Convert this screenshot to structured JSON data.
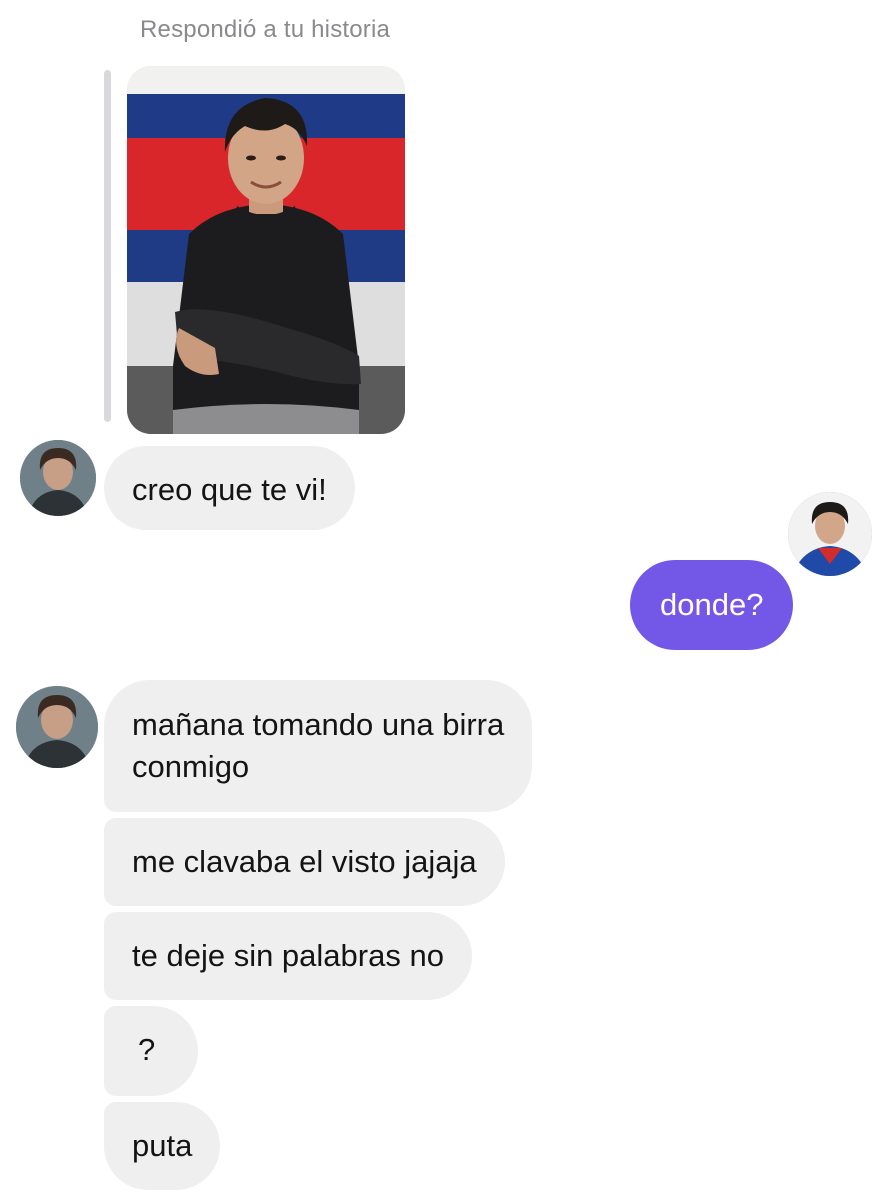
{
  "story": {
    "caption": "Respondió a tu historia"
  },
  "messages": [
    {
      "id": "m1",
      "direction": "received",
      "text": "creo que te vi!"
    },
    {
      "id": "m2",
      "direction": "sent",
      "text": "donde?"
    },
    {
      "id": "m3",
      "direction": "received",
      "lines": [
        "mañana tomando una birra",
        "conmigo"
      ]
    },
    {
      "id": "m4",
      "direction": "received",
      "text": "me clavaba el visto jajaja"
    },
    {
      "id": "m5",
      "direction": "received",
      "text": "te deje sin palabras no"
    },
    {
      "id": "m6",
      "direction": "received",
      "text": "?"
    },
    {
      "id": "m7",
      "direction": "received",
      "text": "puta"
    }
  ],
  "colors": {
    "sent_bubble": "#7357e6",
    "received_bubble": "#efefef",
    "caption_text": "#8a8a8e"
  }
}
